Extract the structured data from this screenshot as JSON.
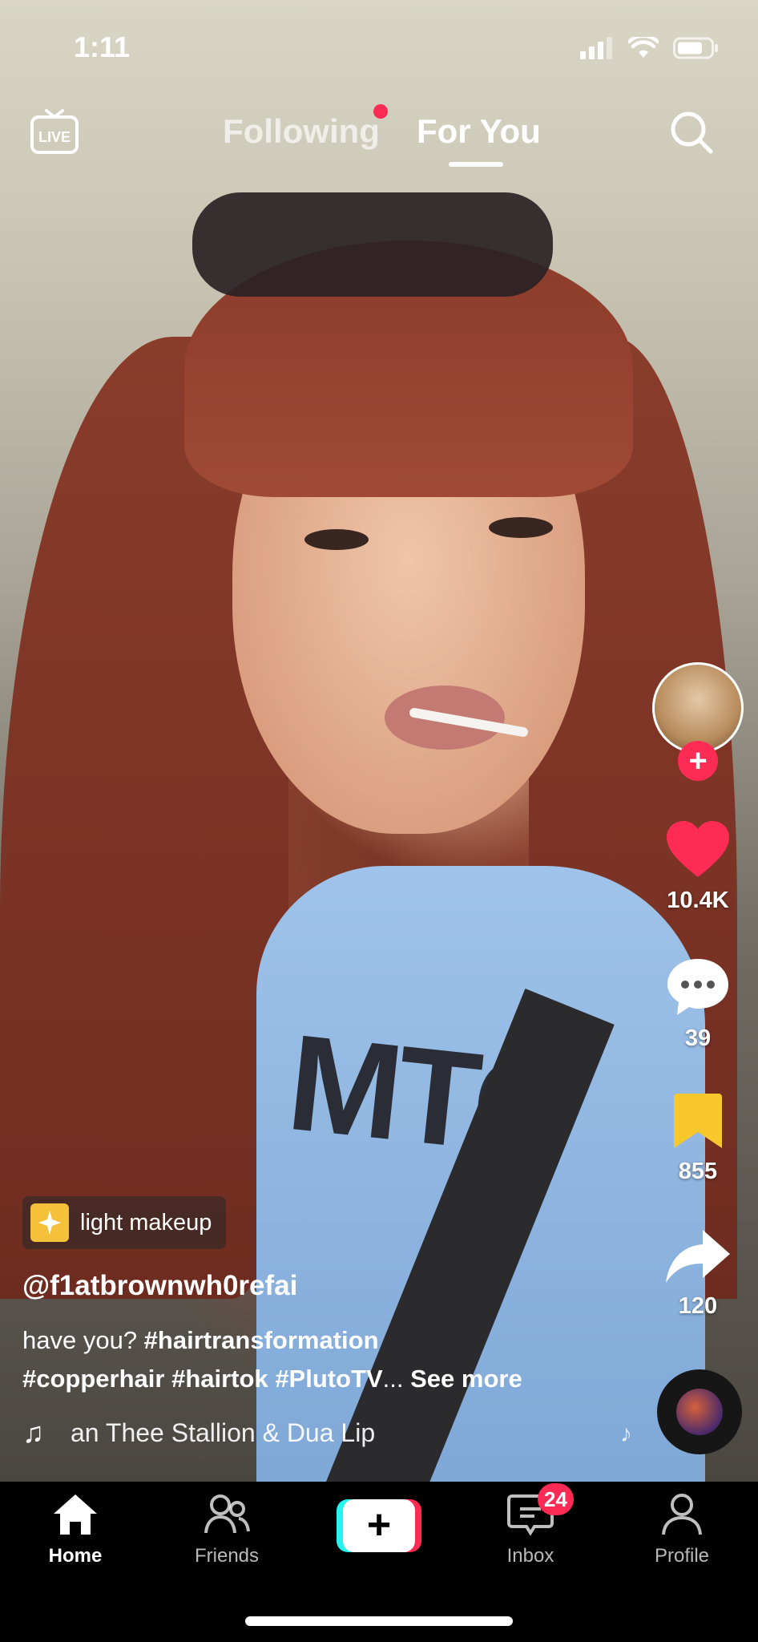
{
  "status_bar": {
    "time": "1:11"
  },
  "top_nav": {
    "live_label": "LIVE",
    "tabs": [
      {
        "label": "Following",
        "active": false,
        "has_dot": true
      },
      {
        "label": "For You",
        "active": true
      }
    ]
  },
  "actions": {
    "likes": "10.4K",
    "comments": "39",
    "saves": "855",
    "shares": "120"
  },
  "post": {
    "effect_label": "light makeup",
    "username": "@f1atbrownwh0refai",
    "desc_text": "have you? ",
    "hashtags": [
      "#hairtransformation",
      "#copperhair",
      "#hairtok",
      "#PlutoTV"
    ],
    "ellipsis": "...",
    "see_more": "See more",
    "music": "an Thee Stallion & Dua Lip"
  },
  "tab_bar": {
    "home": "Home",
    "friends": "Friends",
    "inbox": "Inbox",
    "inbox_badge": "24",
    "profile": "Profile"
  },
  "colors": {
    "accent_red": "#fe2c55",
    "save_yellow": "#f8c72b",
    "cyan": "#25f4ee"
  }
}
